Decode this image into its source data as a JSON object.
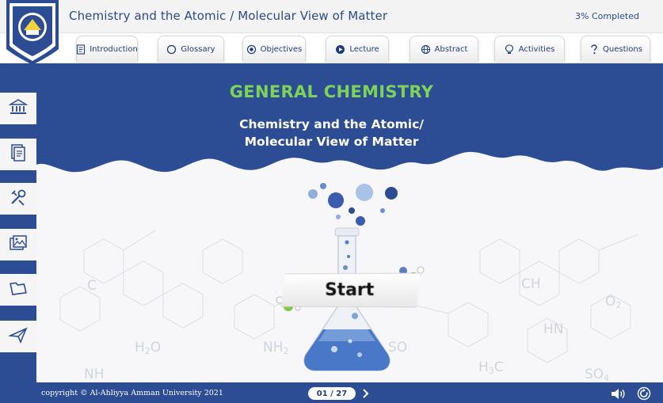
{
  "header": {
    "course_title": "Chemistry and the Atomic / Molecular View of Matter",
    "progress": "3% Completed"
  },
  "tabs": [
    {
      "label": "Introduction",
      "icon": "document-icon"
    },
    {
      "label": "Glossary",
      "icon": "circle-icon"
    },
    {
      "label": "Objectives",
      "icon": "target-icon"
    },
    {
      "label": "Lecture",
      "icon": "play-icon"
    },
    {
      "label": "Abstract",
      "icon": "globe-icon"
    },
    {
      "label": "Activities",
      "icon": "lightbulb-icon"
    },
    {
      "label": "Questions",
      "icon": "question-icon"
    }
  ],
  "sidebar": [
    {
      "name": "university-icon"
    },
    {
      "name": "documents-icon"
    },
    {
      "name": "tools-icon"
    },
    {
      "name": "gallery-icon"
    },
    {
      "name": "folder-icon"
    },
    {
      "name": "send-icon"
    }
  ],
  "hero": {
    "general": "GENERAL CHEMISTRY",
    "subtitle_line1": "Chemistry and the Atomic/",
    "subtitle_line2": "Molecular View of Matter",
    "start_label": "Start"
  },
  "background_labels": [
    "C",
    "H2O",
    "NH",
    "NH2",
    "SO",
    "H3C",
    "CH",
    "O2",
    "HN",
    "SO4"
  ],
  "footer": {
    "copyright": "copyright © Al-Ahliyya Amman University 2021",
    "page": "01 / 27"
  },
  "colors": {
    "brand_blue": "#2c4c93",
    "accent_green": "#7dd35a",
    "light_bg": "#f7f7f9"
  }
}
